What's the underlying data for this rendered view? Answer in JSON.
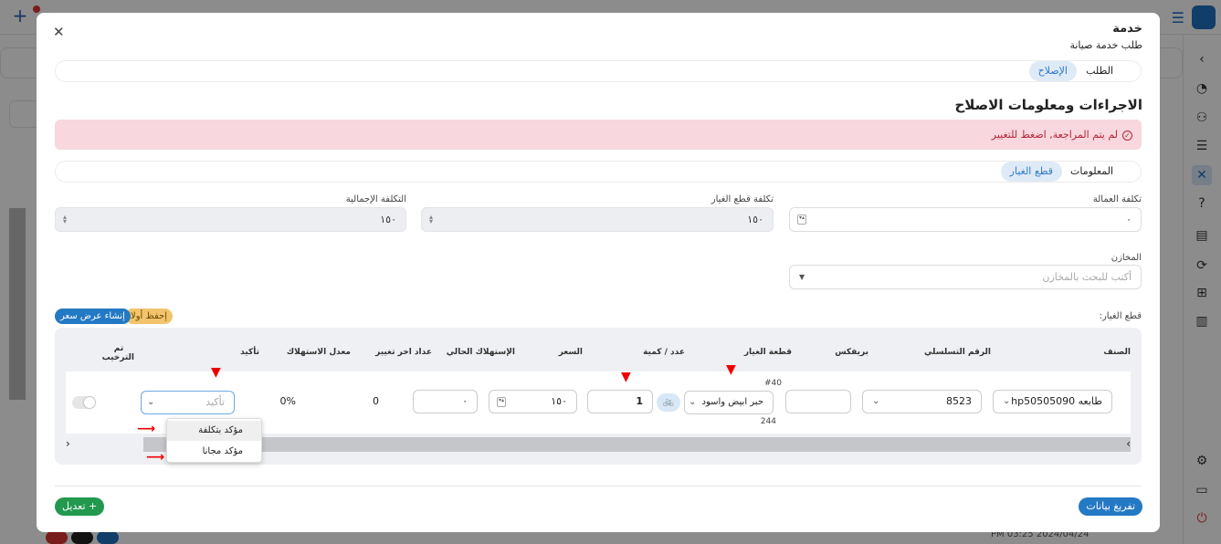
{
  "modal": {
    "title": "خدمة",
    "subtitle": "طلب خدمة صيانة",
    "tabs": [
      {
        "label": "الطلب"
      },
      {
        "label": "الإصلاح"
      }
    ],
    "section_title": "الاجراءات ومعلومات الاصلاح",
    "alert": "لم يتم المراجعة, اضغط للتغيير",
    "inner_tabs": [
      {
        "label": "المعلومات"
      },
      {
        "label": "قطع الغيار"
      }
    ],
    "costs": {
      "labor_label": "تكلفة العمالة",
      "labor_value": "٠",
      "parts_label": "تكلفة قطع الغيار",
      "parts_value": "١٥٠",
      "total_label": "التكلفة الإجمالية",
      "total_value": "١٥٠"
    },
    "stores": {
      "label": "المخازن",
      "placeholder": "أكتب للبحث بالمخازن"
    },
    "parts_label": "قطع الغيار:",
    "save_first": "إحفظ أولا",
    "create_quote": "إنشاء عرض سعر",
    "table": {
      "headers": {
        "category": "الصنف",
        "serial": "الرقم التسلسلي",
        "prefix": "بريفكس",
        "part": "قطعة الغيار",
        "qty": "عدد / كمية",
        "price": "السعر",
        "current_consumption": "الإستهلاك الحالي",
        "last_counter": "عداد اخر تغيير",
        "consumption_rate": "معدل الاستهلاك",
        "confirm": "تأكيد",
        "installed": "تم الترخيب"
      },
      "row": {
        "category": "طابعه hp50505090",
        "serial": "8523",
        "prefix": "",
        "part_code": "#40",
        "part": "حبر ابيض واسود",
        "part_stock": "244",
        "qty": "1",
        "price": "١٥٠",
        "current_consumption": "٠",
        "last_counter": "0",
        "consumption_rate": "0%",
        "confirm_placeholder": "تأكيد"
      }
    },
    "confirm_options": [
      "مؤكد بتكلفة",
      "مؤكد مجانا"
    ],
    "edit_button": "+ تعديل",
    "unload_button": "تفريغ بيانات"
  },
  "background": {
    "timestamp": "PM 03:25 2024/04/24"
  }
}
